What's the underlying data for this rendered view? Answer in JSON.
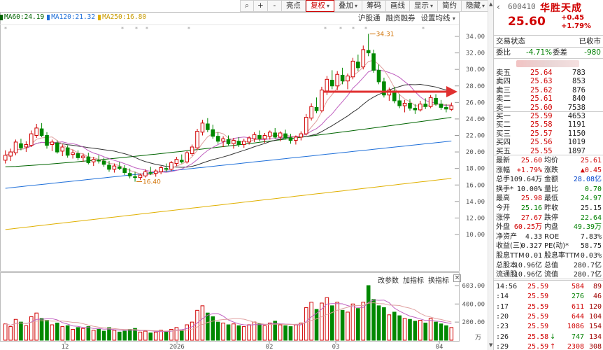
{
  "toolbar": {
    "buttons": [
      {
        "label": "",
        "icon": "search-icon"
      },
      {
        "label": "+",
        "icon": "zoom-in-icon"
      },
      {
        "label": "-",
        "icon": "zoom-out-icon"
      },
      {
        "label": "亮点"
      },
      {
        "label": "复权",
        "dropdown": true,
        "active": true
      },
      {
        "label": "叠加",
        "dropdown": true
      },
      {
        "label": "筹码"
      },
      {
        "label": "画线"
      },
      {
        "label": "显示",
        "dropdown": true
      },
      {
        "label": "简约"
      },
      {
        "label": "隐藏",
        "dropdown": true
      }
    ]
  },
  "subbar": {
    "items": [
      {
        "label": "沪股通"
      },
      {
        "label": "融资融券"
      },
      {
        "label": "设置均线",
        "dropdown": true
      }
    ]
  },
  "ma_legend": [
    {
      "label": "MA60:24.19",
      "color": "#006400"
    },
    {
      "label": "MA120:21.32",
      "color": "#1e6fd9"
    },
    {
      "label": "MA250:16.80",
      "color": "#e0b000"
    }
  ],
  "price_axis": [
    "34.00",
    "32.00",
    "30.00",
    "28.00",
    "26.00",
    "24.00",
    "22.00",
    "20.00",
    "18.00",
    "16.00",
    "14.00",
    "12.00",
    "10.00"
  ],
  "annotations": {
    "high": "34.31",
    "low": "16.40"
  },
  "volume_toolbar": {
    "items": [
      "改参数",
      "加指标",
      "换指标"
    ],
    "close": "×"
  },
  "volume_axis": [
    "603.00",
    "400.00",
    "200.00",
    "万"
  ],
  "date_axis": [
    "12",
    "2026",
    "02",
    "03",
    "04"
  ],
  "candles": [
    [
      19.0,
      20.2,
      18.6,
      19.6
    ],
    [
      19.5,
      20.4,
      18.9,
      20.0
    ],
    [
      19.9,
      21.5,
      19.6,
      21.2
    ],
    [
      21.0,
      21.6,
      20.2,
      20.5
    ],
    [
      20.6,
      21.3,
      20.0,
      20.9
    ],
    [
      20.8,
      22.6,
      20.6,
      22.2
    ],
    [
      22.0,
      23.4,
      21.7,
      22.9
    ],
    [
      22.8,
      23.5,
      21.8,
      22.0
    ],
    [
      22.0,
      22.4,
      20.4,
      20.8
    ],
    [
      20.9,
      21.5,
      20.1,
      21.2
    ],
    [
      21.1,
      21.4,
      19.8,
      20.0
    ],
    [
      20.1,
      20.9,
      19.5,
      20.6
    ],
    [
      20.5,
      20.8,
      19.3,
      19.6
    ],
    [
      19.7,
      20.3,
      19.2,
      19.9
    ],
    [
      19.8,
      20.2,
      19.0,
      19.3
    ],
    [
      19.3,
      19.8,
      18.8,
      19.5
    ],
    [
      19.4,
      19.9,
      18.5,
      18.7
    ],
    [
      18.8,
      19.4,
      18.3,
      19.1
    ],
    [
      19.0,
      19.6,
      18.6,
      18.9
    ],
    [
      18.9,
      19.3,
      18.2,
      18.5
    ],
    [
      18.4,
      18.9,
      17.6,
      17.9
    ],
    [
      17.9,
      18.6,
      17.5,
      18.3
    ],
    [
      18.2,
      18.8,
      17.8,
      18.0
    ],
    [
      18.0,
      18.4,
      17.2,
      17.5
    ],
    [
      17.4,
      18.0,
      16.8,
      17.1
    ],
    [
      17.0,
      17.6,
      16.4,
      16.9
    ],
    [
      16.9,
      17.4,
      16.6,
      17.2
    ],
    [
      17.1,
      17.9,
      16.9,
      17.6
    ],
    [
      17.5,
      18.2,
      17.2,
      17.4
    ],
    [
      17.4,
      17.9,
      17.0,
      17.7
    ],
    [
      17.6,
      18.3,
      17.3,
      18.1
    ],
    [
      18.0,
      18.6,
      17.6,
      17.9
    ],
    [
      17.9,
      18.9,
      17.7,
      18.7
    ],
    [
      18.6,
      19.4,
      18.3,
      19.1
    ],
    [
      19.0,
      19.7,
      18.6,
      18.8
    ],
    [
      18.8,
      20.1,
      18.6,
      19.9
    ],
    [
      19.8,
      20.9,
      19.5,
      20.6
    ],
    [
      20.5,
      22.8,
      20.3,
      22.5
    ],
    [
      22.4,
      23.9,
      22.0,
      23.5
    ],
    [
      23.4,
      24.1,
      22.4,
      22.7
    ],
    [
      22.7,
      23.3,
      21.6,
      21.9
    ],
    [
      21.9,
      22.4,
      21.0,
      21.3
    ],
    [
      21.3,
      21.9,
      20.6,
      21.6
    ],
    [
      21.5,
      22.0,
      20.8,
      21.0
    ],
    [
      21.0,
      21.7,
      20.4,
      21.4
    ],
    [
      21.3,
      21.8,
      20.6,
      20.9
    ],
    [
      20.9,
      21.6,
      20.5,
      21.3
    ],
    [
      21.2,
      21.9,
      20.9,
      21.7
    ],
    [
      21.6,
      22.4,
      21.2,
      22.1
    ],
    [
      22.0,
      22.6,
      21.3,
      21.6
    ],
    [
      21.6,
      22.3,
      21.1,
      22.0
    ],
    [
      21.9,
      22.6,
      21.5,
      22.4
    ],
    [
      22.3,
      22.9,
      21.6,
      21.8
    ],
    [
      21.8,
      22.5,
      21.3,
      22.3
    ],
    [
      22.2,
      22.7,
      21.5,
      21.7
    ],
    [
      21.7,
      22.2,
      21.0,
      21.4
    ],
    [
      21.4,
      22.0,
      20.9,
      21.8
    ],
    [
      21.8,
      22.5,
      21.4,
      22.2
    ],
    [
      22.2,
      24.6,
      22.0,
      24.2
    ],
    [
      24.1,
      25.9,
      23.8,
      25.5
    ],
    [
      25.4,
      26.6,
      24.7,
      25.0
    ],
    [
      25.0,
      27.9,
      24.8,
      27.5
    ],
    [
      27.4,
      29.2,
      26.9,
      28.8
    ],
    [
      28.7,
      29.9,
      27.6,
      28.0
    ],
    [
      28.0,
      29.8,
      27.5,
      29.4
    ],
    [
      29.3,
      30.2,
      28.2,
      28.6
    ],
    [
      28.6,
      29.5,
      27.6,
      29.2
    ],
    [
      29.1,
      31.4,
      28.8,
      31.0
    ],
    [
      30.9,
      31.8,
      29.8,
      30.2
    ],
    [
      30.3,
      32.9,
      30.0,
      32.4
    ],
    [
      32.3,
      34.31,
      31.6,
      32.0
    ],
    [
      31.9,
      32.4,
      29.6,
      29.9
    ],
    [
      29.9,
      30.6,
      28.2,
      28.5
    ],
    [
      28.5,
      29.0,
      26.6,
      26.9
    ],
    [
      26.9,
      27.8,
      26.2,
      27.5
    ],
    [
      27.4,
      27.9,
      25.9,
      26.2
    ],
    [
      26.2,
      27.0,
      25.3,
      25.6
    ],
    [
      25.6,
      26.3,
      24.8,
      25.9
    ],
    [
      25.9,
      26.4,
      25.0,
      25.3
    ],
    [
      25.3,
      25.8,
      24.6,
      25.1
    ],
    [
      25.1,
      26.2,
      24.9,
      25.8
    ],
    [
      25.8,
      26.5,
      25.2,
      25.5
    ],
    [
      25.5,
      26.9,
      25.3,
      26.6
    ],
    [
      26.5,
      27.0,
      25.6,
      25.8
    ],
    [
      25.8,
      26.3,
      25.1,
      25.4
    ],
    [
      25.4,
      25.8,
      24.8,
      25.2
    ],
    [
      25.16,
      25.98,
      24.97,
      25.6
    ]
  ],
  "volumes": [
    180,
    150,
    230,
    200,
    160,
    260,
    300,
    240,
    220,
    170,
    190,
    150,
    160,
    120,
    140,
    130,
    150,
    110,
    120,
    100,
    140,
    110,
    90,
    100,
    120,
    130,
    90,
    100,
    80,
    90,
    110,
    100,
    120,
    140,
    110,
    170,
    200,
    330,
    380,
    300,
    260,
    200,
    190,
    170,
    180,
    160,
    150,
    170,
    200,
    180,
    160,
    190,
    210,
    170,
    160,
    150,
    170,
    190,
    360,
    420,
    340,
    410,
    470,
    380,
    420,
    330,
    310,
    400,
    350,
    420,
    603,
    450,
    380,
    360,
    280,
    310,
    270,
    240,
    230,
    210,
    220,
    190,
    240,
    200,
    180,
    160,
    140
  ],
  "panel": {
    "code": "600410",
    "name": "华胜天成",
    "price": "25.60",
    "change": "+0.45",
    "change_pct": "+1.79%",
    "status_label": "交易状态",
    "status_value": "已收市",
    "weibi_label": "委比",
    "weibi_value": "-4.71%",
    "weicha_label": "委差",
    "weicha_value": "-980",
    "asks": [
      {
        "label": "卖五",
        "price": "25.64",
        "vol": "783"
      },
      {
        "label": "卖四",
        "price": "25.63",
        "vol": "853"
      },
      {
        "label": "卖三",
        "price": "25.62",
        "vol": "876"
      },
      {
        "label": "卖二",
        "price": "25.61",
        "vol": "840"
      },
      {
        "label": "卖一",
        "price": "25.60",
        "vol": "7538"
      }
    ],
    "bids": [
      {
        "label": "买一",
        "price": "25.59",
        "vol": "4653"
      },
      {
        "label": "买二",
        "price": "25.58",
        "vol": "1191"
      },
      {
        "label": "买三",
        "price": "25.57",
        "vol": "1150"
      },
      {
        "label": "买四",
        "price": "25.56",
        "vol": "1019"
      },
      {
        "label": "买五",
        "price": "25.55",
        "vol": "1897"
      }
    ],
    "stats": [
      {
        "l1": "最新",
        "v1": "25.60",
        "c1": "red",
        "l2": "均价",
        "v2": "25.61",
        "c2": "red"
      },
      {
        "l1": "涨幅",
        "v1": "+1.79%",
        "c1": "red",
        "l2": "涨跌",
        "v2": "▲0.45",
        "c2": "red"
      },
      {
        "l1": "总手",
        "v1": "109.64万",
        "c1": "",
        "l2": "金额",
        "v2": "28.08亿",
        "c2": "blue"
      },
      {
        "l1": "换手*",
        "v1": "10.00%",
        "c1": "",
        "l2": "量比",
        "v2": "0.70",
        "c2": "green"
      },
      {
        "l1": "最高",
        "v1": "25.98",
        "c1": "red",
        "l2": "最低",
        "v2": "24.97",
        "c2": "green"
      },
      {
        "l1": "今开",
        "v1": "25.16",
        "c1": "green",
        "l2": "昨收",
        "v2": "25.15",
        "c2": ""
      },
      {
        "l1": "涨停",
        "v1": "27.67",
        "c1": "red",
        "l2": "跌停",
        "v2": "22.64",
        "c2": "green"
      },
      {
        "l1": "外盘",
        "v1": "60.25万",
        "c1": "red",
        "l2": "内盘",
        "v2": "49.39万",
        "c2": "green"
      },
      {
        "l1": "净资产",
        "v1": "4.33",
        "c1": "",
        "l2": "ROE",
        "v2": "7.83%",
        "c2": ""
      },
      {
        "l1": "收益(三)",
        "v1": "0.327",
        "c1": "",
        "l2": "PE(动)*",
        "v2": "58.75",
        "c2": ""
      },
      {
        "l1": "股息TTM",
        "v1": "0.01",
        "c1": "",
        "l2": "股息率TTM",
        "v2": "0.03%",
        "c2": ""
      },
      {
        "l1": "总股本",
        "v1": "10.96亿",
        "c1": "",
        "l2": "总值",
        "v2": "280.7亿",
        "c2": ""
      },
      {
        "l1": "流通股",
        "v1": "10.96亿",
        "c1": "",
        "l2": "流值",
        "v2": "280.7亿",
        "c2": ""
      }
    ],
    "ticks": [
      {
        "time": "14:56",
        "price": "25.59",
        "vol": "584",
        "n": "89",
        "dir": ""
      },
      {
        "time": ":14",
        "price": "25.59",
        "vol": "276",
        "n": "46",
        "dir": ""
      },
      {
        "time": ":17",
        "price": "25.59",
        "vol": "611",
        "n": "120",
        "dir": ""
      },
      {
        "time": ":20",
        "price": "25.59",
        "vol": "644",
        "n": "104",
        "dir": ""
      },
      {
        "time": ":23",
        "price": "25.59",
        "vol": "1086",
        "n": "154",
        "dir": ""
      },
      {
        "time": ":26",
        "price": "25.58",
        "vol": "747",
        "n": "134",
        "dir": "down"
      },
      {
        "time": ":29",
        "price": "25.59",
        "vol": "2308",
        "n": "308",
        "dir": "up"
      }
    ]
  }
}
